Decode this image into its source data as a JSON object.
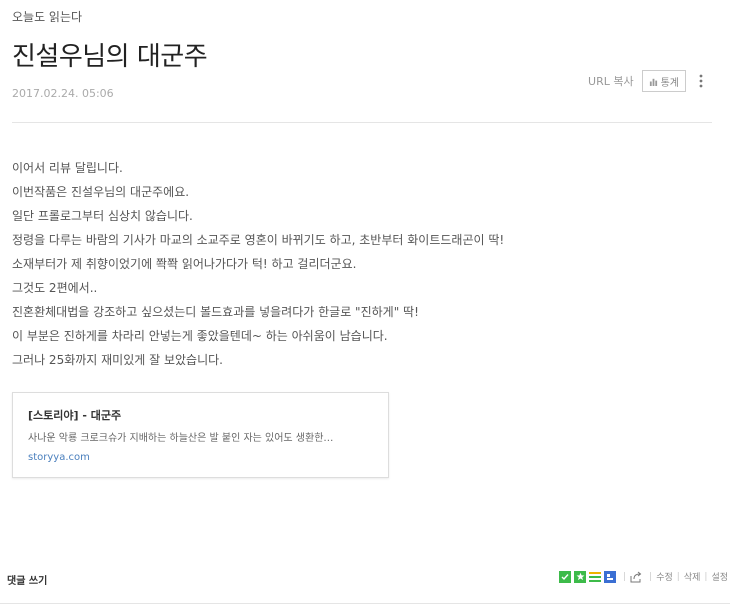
{
  "post": {
    "category": "오늘도 읽는다",
    "title": "진설우님의 대군주",
    "date": "2017.02.24. 05:06"
  },
  "actions": {
    "url_copy": "URL 복사",
    "stats": "통계"
  },
  "content": {
    "lines": [
      "이어서 리뷰 달립니다.",
      "이번작품은 진설우님의 대군주에요.",
      "일단 프롤로그부터 심상치 않습니다.",
      "정령을 다루는 바람의 기사가 마교의 소교주로 영혼이 바뀌기도 하고, 초반부터 화이트드래곤이 딱!",
      "소재부터가 제 취향이었기에 쫙쫙 읽어나가다가 턱! 하고 걸리더군요.",
      "그것도 2편에서..",
      "진혼환체대법을 강조하고 싶으셨는디 볼드효과를 넣을려다가 한글로 \"진하게\" 딱!",
      "이 부분은 진하게를 차라리 안넣는게 좋았을텐데~ 하는 아쉬움이 남습니다.",
      "그러나 25화까지 재미있게 잘 보았습니다."
    ]
  },
  "link_card": {
    "title": "[스토리야] - 대군주",
    "description": "사나운 악룡 크로크슈가 지배하는 하늘산은 발 붙인 자는 있어도 생환한…",
    "url": "storyya.com"
  },
  "footer": {
    "comment_write": "댓글 쓰기",
    "edit": "수정",
    "delete": "삭제",
    "settings": "설정"
  },
  "colors": {
    "accent_green": "#3dbb4a",
    "link_blue": "#4a7fbd"
  }
}
